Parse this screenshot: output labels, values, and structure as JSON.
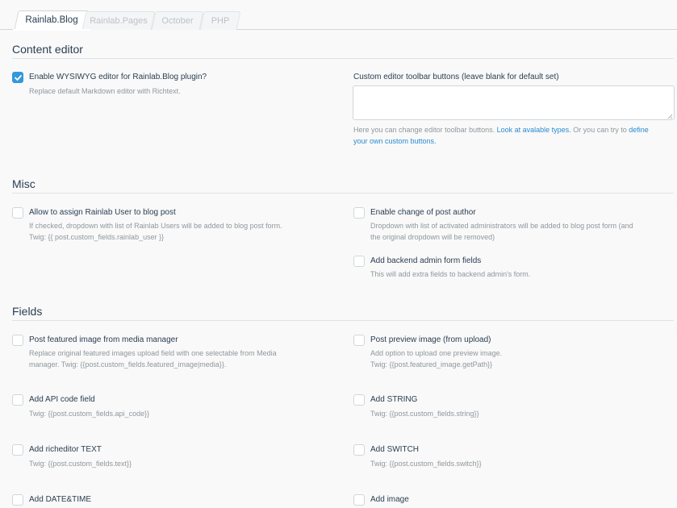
{
  "tabs": [
    {
      "label": "Rainlab.Blog",
      "active": true
    },
    {
      "label": "Rainlab.Pages",
      "active": false
    },
    {
      "label": "October",
      "active": false
    },
    {
      "label": "PHP",
      "active": false
    }
  ],
  "content_editor": {
    "title": "Content editor",
    "wysiwyg": {
      "label": "Enable WYSIWYG editor for Rainlab.Blog plugin?",
      "help": "Replace default Markdown editor with Richtext.",
      "checked": true
    },
    "toolbar": {
      "label": "Custom editor toolbar buttons (leave blank for default set)",
      "value": "",
      "help_prefix": "Here you can change editor toolbar buttons. ",
      "link1": "Look at avalable types.",
      "help_middle": " Or you can try to ",
      "link2_line1": "define",
      "link2_line2": "your own custom buttons."
    }
  },
  "misc": {
    "title": "Misc",
    "rainlab_user": {
      "label": "Allow to assign Rainlab User to blog post",
      "help1": "If checked, dropdown with list of Rainlab Users will be added to blog post form.",
      "help2": "Twig: {{ post.custom_fields.rainlab_user }}"
    },
    "post_author": {
      "label": "Enable change of post author",
      "help1": "Dropdown with list of activated administrators will be added to blog post form (and",
      "help2": "the original dropdown will be removed)"
    },
    "backend_fields": {
      "label": "Add backend admin form fields",
      "help1": "This will add extra fields to backend admin's form."
    }
  },
  "fields": {
    "title": "Fields",
    "featured_image": {
      "label": "Post featured image from media manager",
      "help1": "Replace original featured images upload field with one selectable from Media",
      "help2": "manager. Twig: {{post.custom_fields.featured_image|media}}."
    },
    "preview_image": {
      "label": "Post preview image (from upload)",
      "help1": "Add option to upload one preview image.",
      "help2": "Twig: {{post.featured_image.getPath}}"
    },
    "api_code": {
      "label": "Add API code field",
      "help1": "Twig: {{post.custom_fields.api_code}}"
    },
    "string": {
      "label": "Add STRING",
      "help1": "Twig: {{post.custom_fields.string}}"
    },
    "richeditor": {
      "label": "Add richeditor TEXT",
      "help1": "Twig: {{post.custom_fields.text}}"
    },
    "switch": {
      "label": "Add SWITCH",
      "help1": "Twig: {{post.custom_fields.switch}}"
    },
    "datetime": {
      "label": "Add DATE&TIME"
    },
    "image": {
      "label": "Add image"
    }
  },
  "colors": {
    "accent": "#3498db",
    "link": "#2a8bd2",
    "text": "#2a3e51",
    "muted": "#8f979c"
  }
}
